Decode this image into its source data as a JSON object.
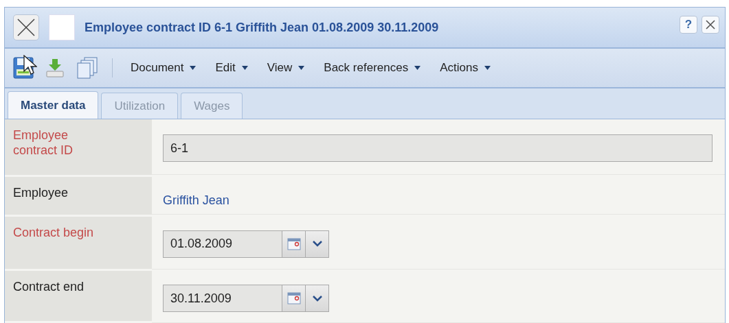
{
  "window": {
    "title": "Employee contract ID 6-1 Griffith Jean 01.08.2009 30.11.2009",
    "help": "?"
  },
  "toolbar": {
    "menus": [
      "Document",
      "Edit",
      "View",
      "Back references",
      "Actions"
    ]
  },
  "tabs": [
    {
      "label": "Master data",
      "selected": true
    },
    {
      "label": "Utilization",
      "selected": false
    },
    {
      "label": "Wages",
      "selected": false
    }
  ],
  "fields": [
    {
      "label": "Employee contract ID",
      "required": true,
      "kind": "text",
      "value": "6-1"
    },
    {
      "label": "Employee",
      "required": false,
      "kind": "link",
      "value": "Griffith Jean"
    },
    {
      "label": "Contract begin",
      "required": true,
      "kind": "date",
      "value": "01.08.2009"
    },
    {
      "label": "Contract end",
      "required": false,
      "kind": "date",
      "value": "30.11.2009"
    }
  ]
}
